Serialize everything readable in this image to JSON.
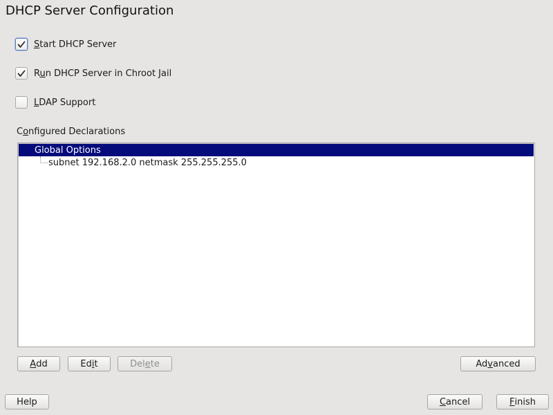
{
  "window": {
    "title": "DHCP Server Configuration"
  },
  "options": {
    "start_server": {
      "before": "",
      "mnemonic": "S",
      "after": "tart DHCP Server",
      "checked": true
    },
    "chroot_jail": {
      "before": "R",
      "mnemonic": "u",
      "after": "n DHCP Server in Chroot Jail",
      "checked": true
    },
    "ldap_support": {
      "before": "",
      "mnemonic": "L",
      "after": "DAP Support",
      "checked": false
    }
  },
  "declarations": {
    "label_before": "C",
    "label_mnemonic": "o",
    "label_after": "nfigured Declarations",
    "items": [
      {
        "text": "Global Options",
        "selected": true
      },
      {
        "text": "subnet 192.168.2.0 netmask 255.255.255.0",
        "selected": false
      }
    ]
  },
  "buttons": {
    "add": {
      "before": "",
      "mnemonic": "A",
      "after": "dd"
    },
    "edit": {
      "before": "Ed",
      "mnemonic": "i",
      "after": "t"
    },
    "delete": {
      "before": "Del",
      "mnemonic": "e",
      "after": "te",
      "enabled": false
    },
    "advanced": {
      "before": "Ad",
      "mnemonic": "v",
      "after": "anced"
    },
    "help": {
      "before": "Help",
      "mnemonic": "",
      "after": ""
    },
    "cancel": {
      "before": "",
      "mnemonic": "C",
      "after": "ancel"
    },
    "finish": {
      "before": "",
      "mnemonic": "F",
      "after": "inish"
    }
  },
  "colors": {
    "background": "#e6e5e4",
    "selection": "#050b7a",
    "focus_border": "#5f7fb8"
  },
  "icons": {
    "checkmark": "checkmark-icon"
  }
}
